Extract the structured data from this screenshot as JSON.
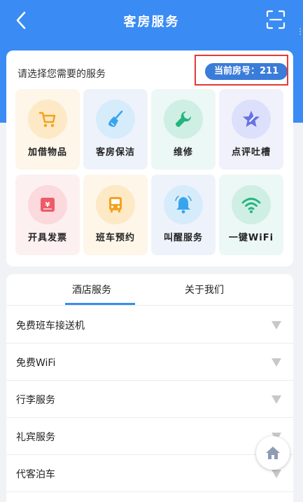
{
  "header": {
    "title": "客房服务",
    "back_icon": "chevron-left-icon",
    "scan_icon": "scan-icon",
    "background_color": "#3a8bf3"
  },
  "services_card": {
    "prompt": "请选择您需要的服务",
    "room_badge": "当前房号：211",
    "tiles": [
      {
        "label": "加借物品",
        "icon": "cart-icon",
        "bg": "#fdf6e9",
        "circle": "#fde9c6",
        "icon_color": "#f4a21d"
      },
      {
        "label": "客房保洁",
        "icon": "broom-icon",
        "bg": "#eef3fb",
        "circle": "#d7ecfb",
        "icon_color": "#39a4ee"
      },
      {
        "label": "维修",
        "icon": "wrench-icon",
        "bg": "#ecf8f5",
        "circle": "#cfeee4",
        "icon_color": "#22b57e"
      },
      {
        "label": "点评吐槽",
        "icon": "star-pen-icon",
        "bg": "#f1f1fc",
        "circle": "#dde0fa",
        "icon_color": "#6673e4"
      },
      {
        "label": "开具发票",
        "icon": "invoice-icon",
        "bg": "#fdf0f0",
        "circle": "#fbd9dc",
        "icon_color": "#ee5a6a"
      },
      {
        "label": "班车预约",
        "icon": "bus-icon",
        "bg": "#fdf6e9",
        "circle": "#fde9c6",
        "icon_color": "#f4a21d"
      },
      {
        "label": "叫醒服务",
        "icon": "bell-icon",
        "bg": "#eef3fb",
        "circle": "#d7ecfb",
        "icon_color": "#39a4ee"
      },
      {
        "label": "一键WiFi",
        "icon": "wifi-icon",
        "bg": "#ecf8f5",
        "circle": "#cfeee4",
        "icon_color": "#22b57e"
      }
    ]
  },
  "tabs": [
    {
      "label": "酒店服务",
      "active": true
    },
    {
      "label": "关于我们",
      "active": false
    }
  ],
  "service_list": [
    {
      "label": "免费班车接送机"
    },
    {
      "label": "免费WiFi"
    },
    {
      "label": "行李服务"
    },
    {
      "label": "礼宾服务"
    },
    {
      "label": "代客泊车"
    }
  ],
  "floating_button": {
    "icon": "home-icon"
  }
}
